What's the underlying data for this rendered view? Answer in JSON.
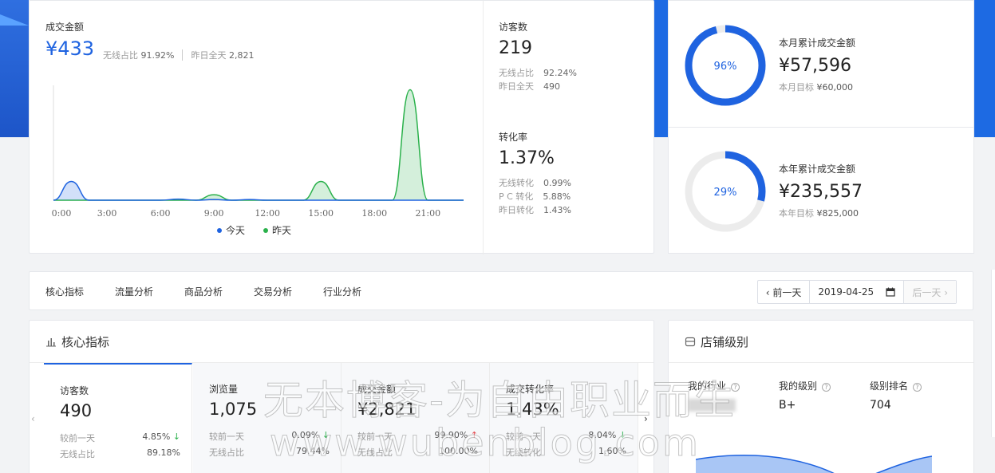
{
  "sales": {
    "title": "成交金额",
    "value": "¥433",
    "wireless_label": "无线占比",
    "wireless_value": "91.92%",
    "yesterday_label": "昨日全天",
    "yesterday_value": "2,821"
  },
  "visitors": {
    "title": "访客数",
    "value": "219",
    "rows": [
      {
        "label": "无线占比",
        "value": "92.24%"
      },
      {
        "label": "昨日全天",
        "value": "490"
      }
    ]
  },
  "conversion": {
    "title": "转化率",
    "value": "1.37%",
    "rows": [
      {
        "label": "无线转化",
        "value": "0.99%"
      },
      {
        "label": "P C 转化",
        "value": "5.88%"
      },
      {
        "label": "昨日转化",
        "value": "1.43%"
      }
    ]
  },
  "chart_data": {
    "type": "area",
    "x_ticks": [
      "0:00",
      "3:00",
      "6:00",
      "9:00",
      "12:00",
      "15:00",
      "18:00",
      "21:00"
    ],
    "series": [
      {
        "name": "今天",
        "color": "#1f63e0",
        "x": [
          0,
          1,
          2,
          3,
          4,
          5,
          6,
          7,
          8,
          9,
          10,
          11,
          12,
          13,
          14,
          15,
          16,
          17,
          18,
          19,
          20,
          21,
          22,
          23
        ],
        "values": [
          0,
          85,
          0,
          0,
          0,
          0,
          0,
          5,
          0,
          3,
          0,
          3,
          0,
          0,
          0,
          0,
          0,
          0,
          0,
          0,
          0,
          0,
          0,
          0
        ]
      },
      {
        "name": "昨天",
        "color": "#2ab14b",
        "x": [
          0,
          1,
          2,
          3,
          4,
          5,
          6,
          7,
          8,
          9,
          10,
          11,
          12,
          13,
          14,
          15,
          16,
          17,
          18,
          19,
          20,
          21,
          22,
          23
        ],
        "values": [
          0,
          0,
          0,
          0,
          0,
          0,
          0,
          0,
          0,
          25,
          0,
          0,
          0,
          0,
          0,
          85,
          0,
          0,
          0,
          0,
          500,
          0,
          0,
          0
        ]
      }
    ],
    "ylim": [
      0,
      520
    ]
  },
  "month_goal": {
    "percent": "96%",
    "fraction": 0.96,
    "title": "本月累计成交金额",
    "value": "¥57,596",
    "target_label": "本月目标",
    "target_value": "¥60,000"
  },
  "year_goal": {
    "percent": "29%",
    "fraction": 0.29,
    "title": "本年累计成交金额",
    "value": "¥235,557",
    "target_label": "本年目标",
    "target_value": "¥825,000"
  },
  "tabs": [
    "核心指标",
    "流量分析",
    "商品分析",
    "交易分析",
    "行业分析"
  ],
  "date_nav": {
    "prev": "‹ 前一天",
    "date": "2019-04-25",
    "next": "后一天 ›"
  },
  "core": {
    "title": "核心指标",
    "compare_label": "较前一天",
    "metrics": [
      {
        "title": "访客数",
        "value": "490",
        "change": "4.85%",
        "dir": "down",
        "sub_label": "无线占比",
        "sub_value": "89.18%"
      },
      {
        "title": "浏览量",
        "value": "1,075",
        "change": "0.09%",
        "dir": "down",
        "sub_label": "无线占比",
        "sub_value": "79.44%"
      },
      {
        "title": "成交金额",
        "value": "¥2,821",
        "change": "99.90%",
        "dir": "up",
        "sub_label": "无线占比",
        "sub_value": "100.00%"
      },
      {
        "title": "成交转化率",
        "value": "1.43%",
        "change": "8.04%",
        "dir": "down",
        "sub_label": "无线转化",
        "sub_value": "1.60%"
      }
    ]
  },
  "shop": {
    "title": "店铺级别",
    "industry_label": "我的行业",
    "level_label": "我的级别",
    "level_value": "B+",
    "rank_label": "级别排名",
    "rank_value": "704"
  },
  "watermark": {
    "line1": "无本博客-为自由职业而生",
    "line2": "www.wubenblog.com"
  }
}
